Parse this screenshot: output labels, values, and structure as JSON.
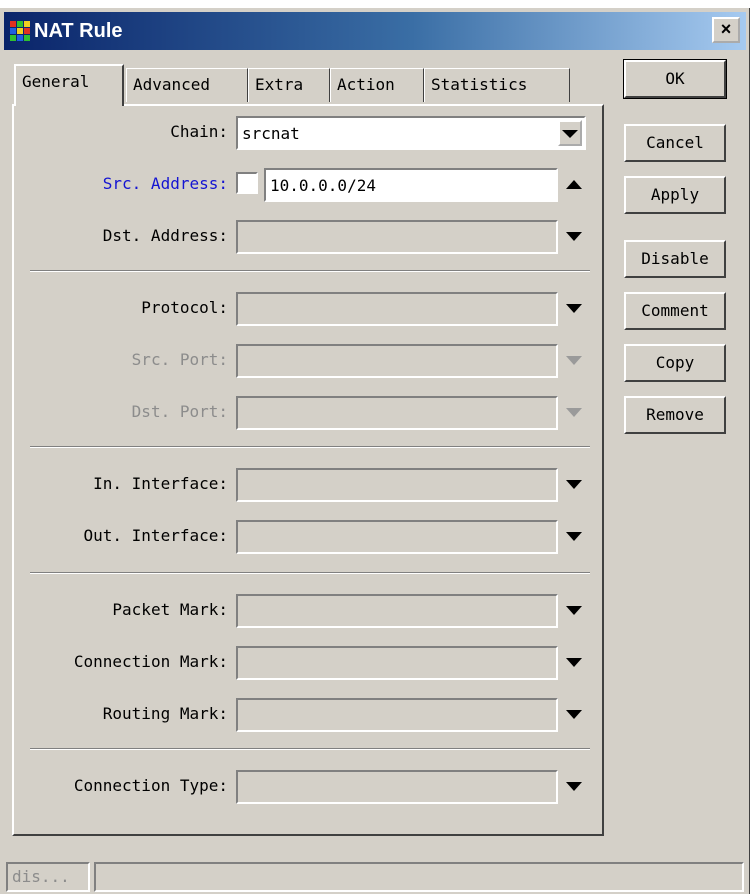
{
  "window": {
    "title": "NAT Rule",
    "close_label": "×"
  },
  "tabs": [
    {
      "label": "General",
      "active": true
    },
    {
      "label": "Advanced",
      "active": false
    },
    {
      "label": "Extra",
      "active": false
    },
    {
      "label": "Action",
      "active": false
    },
    {
      "label": "Statistics",
      "active": false
    }
  ],
  "form": {
    "chain": {
      "label": "Chain:",
      "value": "srcnat"
    },
    "src_address": {
      "label": "Src. Address:",
      "value": "10.0.0.0/24",
      "negate_checked": false
    },
    "dst_address": {
      "label": "Dst. Address:",
      "value": ""
    },
    "protocol": {
      "label": "Protocol:",
      "value": ""
    },
    "src_port": {
      "label": "Src. Port:",
      "value": ""
    },
    "dst_port": {
      "label": "Dst. Port:",
      "value": ""
    },
    "in_interface": {
      "label": "In. Interface:",
      "value": ""
    },
    "out_interface": {
      "label": "Out. Interface:",
      "value": ""
    },
    "packet_mark": {
      "label": "Packet Mark:",
      "value": ""
    },
    "connection_mark": {
      "label": "Connection Mark:",
      "value": ""
    },
    "routing_mark": {
      "label": "Routing Mark:",
      "value": ""
    },
    "connection_type": {
      "label": "Connection Type:",
      "value": ""
    }
  },
  "buttons": {
    "ok": "OK",
    "cancel": "Cancel",
    "apply": "Apply",
    "disable": "Disable",
    "comment": "Comment",
    "copy": "Copy",
    "remove": "Remove"
  },
  "status": {
    "left": "dis...",
    "right": ""
  },
  "colors": {
    "title_gradient_start": "#0a246a",
    "title_gradient_end": "#a6caf0",
    "highlight_label": "#1414d2",
    "disabled_label": "#8c8c8c",
    "face": "#d4d0c8"
  }
}
